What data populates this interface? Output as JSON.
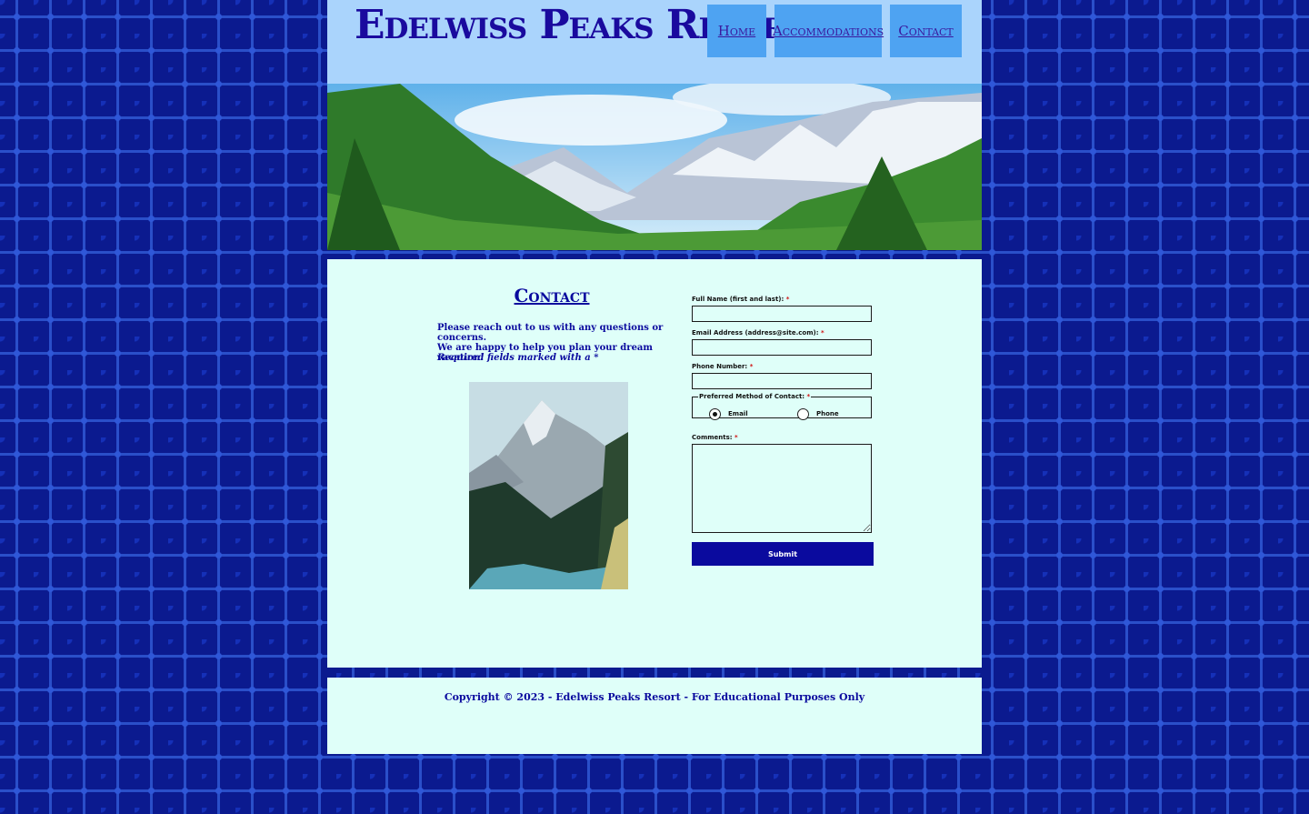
{
  "site": {
    "title": "Edelwiss Peaks Resort"
  },
  "nav": {
    "items": [
      {
        "label": "Home"
      },
      {
        "label": "Accommodations"
      },
      {
        "label": "Contact"
      }
    ]
  },
  "main": {
    "heading": "Contact",
    "intro_line1": "Please reach out to us with any questions or concerns.",
    "intro_line2": "We are happy to help you plan your dream vacation!",
    "required_note": "Required fields marked with a *"
  },
  "form": {
    "full_name_label": "Full Name (first and last):",
    "email_label": "Email Address (address@site.com):",
    "phone_label": "Phone Number:",
    "contact_method_label": "Preferred Method of Contact:",
    "option_email": "Email",
    "option_phone": "Phone",
    "selected_method": "Email",
    "comments_label": "Comments:",
    "required_mark": "*",
    "submit_label": "Submit"
  },
  "footer": {
    "copyright": "Copyright © 2023 - Edelwiss Peaks Resort - For Educational Purposes Only"
  },
  "colors": {
    "header_bg": "#aad4fc",
    "nav_bg": "#4ea3f2",
    "content_bg": "#dffff9",
    "accent": "#0a0a9e"
  }
}
